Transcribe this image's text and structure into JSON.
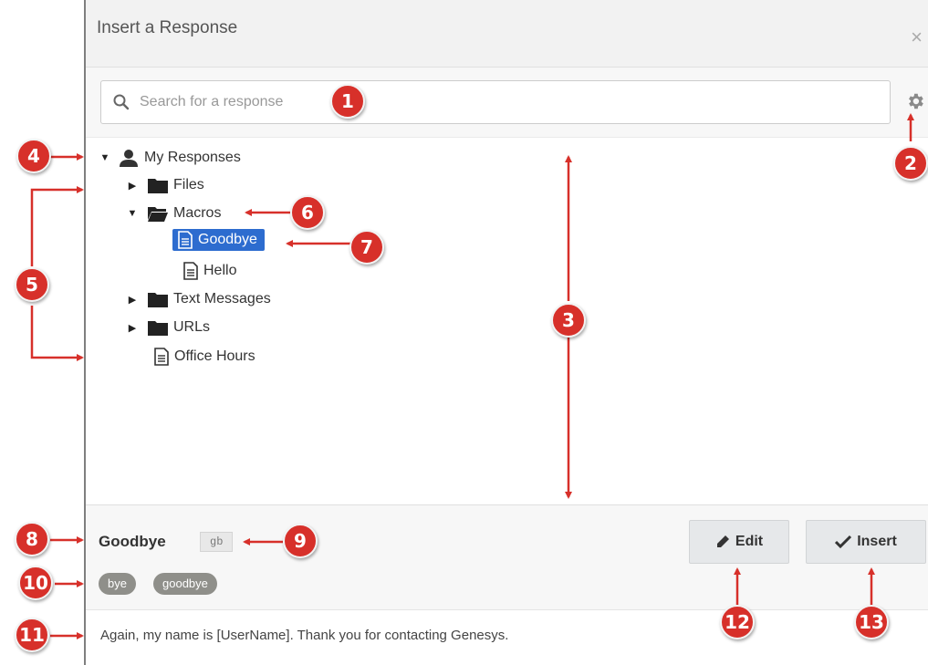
{
  "header": {
    "title": "Insert a Response",
    "close_glyph": "×"
  },
  "search": {
    "placeholder": "Search for a response",
    "value": ""
  },
  "tree": {
    "root": "My Responses",
    "items": [
      {
        "label": "Files",
        "icon": "folder-icon",
        "expanded": false
      },
      {
        "label": "Macros",
        "icon": "folder-open-icon",
        "expanded": true
      },
      {
        "label": "Goodbye",
        "icon": "document-icon",
        "selected": true
      },
      {
        "label": "Hello",
        "icon": "document-icon"
      },
      {
        "label": "Text Messages",
        "icon": "folder-icon",
        "expanded": false
      },
      {
        "label": "URLs",
        "icon": "folder-icon",
        "expanded": false
      },
      {
        "label": "Office Hours",
        "icon": "document-icon"
      }
    ]
  },
  "details": {
    "name": "Goodbye",
    "shortcut": "gb",
    "tags": [
      "bye",
      "goodbye"
    ],
    "edit_label": "Edit",
    "insert_label": "Insert",
    "body": "Again, my name is [UserName]. Thank you for contacting Genesys."
  },
  "callouts": [
    "1",
    "2",
    "3",
    "4",
    "5",
    "6",
    "7",
    "8",
    "9",
    "10",
    "11",
    "12",
    "13"
  ],
  "colors": {
    "selected": "#2d6ccf",
    "callout": "#d7302a",
    "tag": "#8f8f8a"
  }
}
